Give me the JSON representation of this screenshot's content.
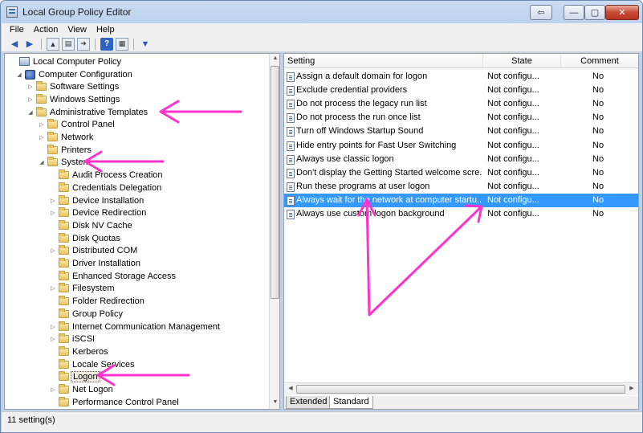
{
  "window": {
    "title": "Local Group Policy Editor"
  },
  "controls": {
    "restore": "⇦",
    "minimize": "—",
    "maximize": "▢",
    "close": "✕"
  },
  "menu": [
    "File",
    "Action",
    "View",
    "Help"
  ],
  "toolbar_icons": [
    "back-icon",
    "forward-icon",
    "up-folder-icon",
    "show-tree-icon",
    "export-icon",
    "help-icon",
    "properties-icon",
    "filter-icon"
  ],
  "tree": [
    {
      "label": "Local Computer Policy",
      "depth": 0,
      "tw": "",
      "icon": "pc"
    },
    {
      "label": "Computer Configuration",
      "depth": 1,
      "tw": "◢",
      "icon": "cfg"
    },
    {
      "label": "Software Settings",
      "depth": 2,
      "tw": "▷",
      "icon": "folder"
    },
    {
      "label": "Windows Settings",
      "depth": 2,
      "tw": "▷",
      "icon": "folder"
    },
    {
      "label": "Administrative Templates",
      "depth": 2,
      "tw": "◢",
      "icon": "folder"
    },
    {
      "label": "Control Panel",
      "depth": 3,
      "tw": "▷",
      "icon": "folder"
    },
    {
      "label": "Network",
      "depth": 3,
      "tw": "▷",
      "icon": "folder"
    },
    {
      "label": "Printers",
      "depth": 3,
      "tw": "",
      "icon": "folder"
    },
    {
      "label": "System",
      "depth": 3,
      "tw": "◢",
      "icon": "folder"
    },
    {
      "label": "Audit Process Creation",
      "depth": 4,
      "tw": "",
      "icon": "folder"
    },
    {
      "label": "Credentials Delegation",
      "depth": 4,
      "tw": "",
      "icon": "folder"
    },
    {
      "label": "Device Installation",
      "depth": 4,
      "tw": "▷",
      "icon": "folder"
    },
    {
      "label": "Device Redirection",
      "depth": 4,
      "tw": "▷",
      "icon": "folder"
    },
    {
      "label": "Disk NV Cache",
      "depth": 4,
      "tw": "",
      "icon": "folder"
    },
    {
      "label": "Disk Quotas",
      "depth": 4,
      "tw": "",
      "icon": "folder"
    },
    {
      "label": "Distributed COM",
      "depth": 4,
      "tw": "▷",
      "icon": "folder"
    },
    {
      "label": "Driver Installation",
      "depth": 4,
      "tw": "",
      "icon": "folder"
    },
    {
      "label": "Enhanced Storage Access",
      "depth": 4,
      "tw": "",
      "icon": "folder"
    },
    {
      "label": "Filesystem",
      "depth": 4,
      "tw": "▷",
      "icon": "folder"
    },
    {
      "label": "Folder Redirection",
      "depth": 4,
      "tw": "",
      "icon": "folder"
    },
    {
      "label": "Group Policy",
      "depth": 4,
      "tw": "",
      "icon": "folder"
    },
    {
      "label": "Internet Communication Management",
      "depth": 4,
      "tw": "▷",
      "icon": "folder"
    },
    {
      "label": "iSCSI",
      "depth": 4,
      "tw": "▷",
      "icon": "folder"
    },
    {
      "label": "Kerberos",
      "depth": 4,
      "tw": "",
      "icon": "folder"
    },
    {
      "label": "Locale Services",
      "depth": 4,
      "tw": "",
      "icon": "folder"
    },
    {
      "label": "Logon",
      "depth": 4,
      "tw": "",
      "icon": "folder",
      "selected": true
    },
    {
      "label": "Net Logon",
      "depth": 4,
      "tw": "▷",
      "icon": "folder"
    },
    {
      "label": "Performance Control Panel",
      "depth": 4,
      "tw": "",
      "icon": "folder"
    }
  ],
  "list": {
    "columns": [
      "Setting",
      "State",
      "Comment"
    ],
    "rows": [
      {
        "setting": "Assign a default domain for logon",
        "state": "Not configu...",
        "comment": "No"
      },
      {
        "setting": "Exclude credential providers",
        "state": "Not configu...",
        "comment": "No"
      },
      {
        "setting": "Do not process the legacy run list",
        "state": "Not configu...",
        "comment": "No"
      },
      {
        "setting": "Do not process the run once list",
        "state": "Not configu...",
        "comment": "No"
      },
      {
        "setting": "Turn off Windows Startup Sound",
        "state": "Not configu...",
        "comment": "No"
      },
      {
        "setting": "Hide entry points for Fast User Switching",
        "state": "Not configu...",
        "comment": "No"
      },
      {
        "setting": "Always use classic logon",
        "state": "Not configu...",
        "comment": "No"
      },
      {
        "setting": "Don't display the Getting Started welcome scre...",
        "state": "Not configu...",
        "comment": "No"
      },
      {
        "setting": "Run these programs at user logon",
        "state": "Not configu...",
        "comment": "No"
      },
      {
        "setting": "Always wait for the network at computer startu...",
        "state": "Not configu...",
        "comment": "No",
        "selected": true
      },
      {
        "setting": "Always use custom logon background",
        "state": "Not configu...",
        "comment": "No"
      }
    ]
  },
  "tabs": [
    "Extended",
    "Standard"
  ],
  "active_tab": "Standard",
  "status": {
    "text": "11 setting(s)"
  },
  "annotation_color": "#ff33cc"
}
